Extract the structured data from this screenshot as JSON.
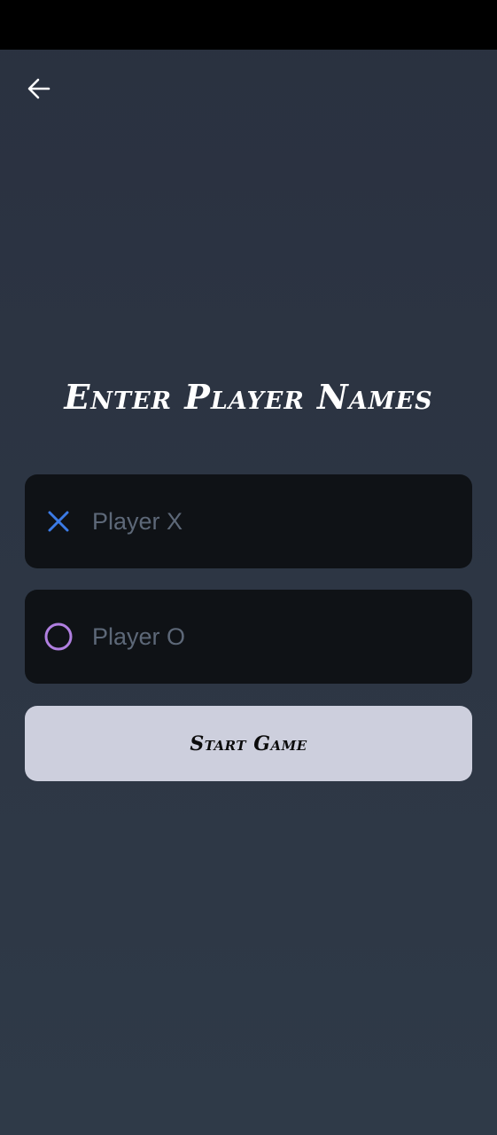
{
  "header": {
    "back_icon": "arrow-left-icon"
  },
  "title": "Enter Player Names",
  "players": [
    {
      "icon": "x-mark-icon",
      "icon_color": "#3b7be6",
      "placeholder": "Player X",
      "value": ""
    },
    {
      "icon": "circle-o-icon",
      "icon_color": "#b07fe0",
      "placeholder": "Player O",
      "value": ""
    }
  ],
  "start_button": {
    "label": "Start Game"
  },
  "colors": {
    "background": "#2c3442",
    "field_background": "#0f1216",
    "button_background": "#cdcfdd",
    "title_text": "#ffffff"
  }
}
